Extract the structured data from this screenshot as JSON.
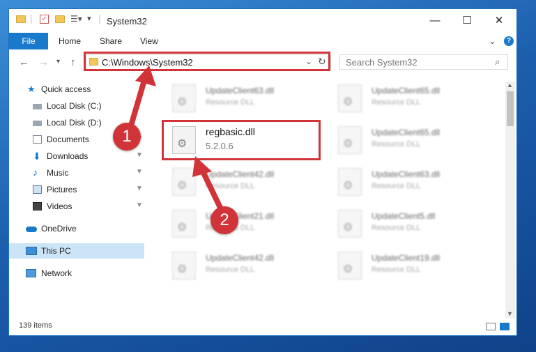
{
  "window": {
    "title": "System32",
    "controls": {
      "minimize": "—",
      "maximize": "☐",
      "close": "✕"
    }
  },
  "ribbon": {
    "tabs": [
      "File",
      "Home",
      "Share",
      "View"
    ],
    "collapse": "⌄",
    "help": "?"
  },
  "address": {
    "path": "C:\\Windows\\System32",
    "search_placeholder": "Search System32"
  },
  "nav": {
    "items": [
      {
        "label": "Quick access",
        "icon": "star-icon",
        "pinned": false
      },
      {
        "label": "Local Disk (C:)",
        "icon": "drive-icon",
        "pinned": false
      },
      {
        "label": "Local Disk (D:)",
        "icon": "drive-icon",
        "pinned": false
      },
      {
        "label": "Documents",
        "icon": "documents-icon",
        "pinned": true
      },
      {
        "label": "Downloads",
        "icon": "download-icon",
        "pinned": true
      },
      {
        "label": "Music",
        "icon": "music-icon",
        "pinned": true
      },
      {
        "label": "Pictures",
        "icon": "pictures-icon",
        "pinned": true
      },
      {
        "label": "Videos",
        "icon": "videos-icon",
        "pinned": true
      },
      {
        "label": "OneDrive",
        "icon": "cloud-icon",
        "pinned": false
      },
      {
        "label": "This PC",
        "icon": "computer-icon",
        "pinned": false
      },
      {
        "label": "Network",
        "icon": "network-icon",
        "pinned": false
      }
    ],
    "pin_glyph": "📌"
  },
  "files": [
    {
      "name": "UpdateClient63.dll",
      "type": "Resource DLL"
    },
    {
      "name": "UpdateClient65.dll",
      "type": "Resource DLL"
    },
    {
      "name": "regbasic.dll",
      "type": "5.2.0.6"
    },
    {
      "name": "UpdateClient65.dll",
      "type": "Resource DLL"
    },
    {
      "name": "UpdateClient42.dll",
      "type": "Resource DLL"
    },
    {
      "name": "UpdateClient63.dll",
      "type": "Resource DLL"
    },
    {
      "name": "UpdateClient21.dll",
      "type": "Resource DLL"
    },
    {
      "name": "UpdateClient5.dll",
      "type": "Resource DLL"
    },
    {
      "name": "UpdateClient42.dll",
      "type": "Resource DLL"
    },
    {
      "name": "UpdateClient19.dll",
      "type": "Resource DLL"
    }
  ],
  "status": {
    "count": "139 items"
  },
  "annotations": {
    "step1": "1",
    "step2": "2",
    "color": "#d13438"
  },
  "colors": {
    "accent": "#1979ca",
    "selected": "#cce4f7",
    "highlight": "#d13438"
  }
}
